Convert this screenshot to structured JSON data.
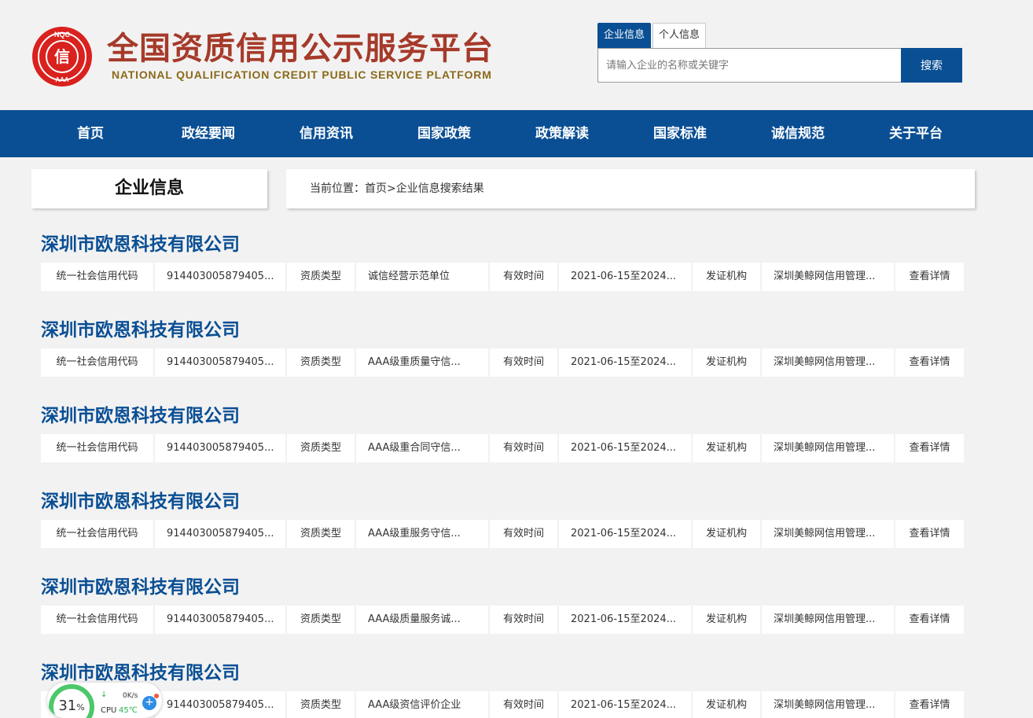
{
  "brand": {
    "logo_text_top": "NQC",
    "logo_char": "信",
    "logo_text_bottom": "AAA",
    "title": "全国资质信用公示服务平台",
    "subtitle": "NATIONAL QUALIFICATION CREDIT PUBLIC SERVICE PLATFORM",
    "colors": {
      "title": "#a63a2a",
      "subtitle": "#8a6a1a",
      "logo": "#d9211e"
    }
  },
  "search": {
    "tabs": [
      {
        "label": "企业信息",
        "active": true
      },
      {
        "label": "个人信息",
        "active": false
      }
    ],
    "placeholder": "请输入企业的名称或关键字",
    "value": "",
    "button_label": "搜索"
  },
  "nav": {
    "items": [
      "首页",
      "政经要闻",
      "信用资讯",
      "国家政策",
      "政策解读",
      "国家标准",
      "诚信规范",
      "关于平台"
    ],
    "background": "#0a4f94"
  },
  "section": {
    "title": "企业信息",
    "breadcrumb_prefix": "当前位置：",
    "breadcrumb_home": "首页",
    "breadcrumb_sep": ">",
    "breadcrumb_current": "企业信息搜索结果"
  },
  "labels": {
    "credit_code": "统一社会信用代码",
    "qual_type": "资质类型",
    "valid_time": "有效时间",
    "issuer": "发证机构",
    "detail": "查看详情"
  },
  "results": [
    {
      "company": "深圳市欧恩科技有限公司",
      "code": "914403005879405...",
      "type": "诚信经营示范单位",
      "valid": "2021-06-15至2024...",
      "issuer": "深圳美鲸网信用管理..."
    },
    {
      "company": "深圳市欧恩科技有限公司",
      "code": "914403005879405...",
      "type": "AAA级重质量守信...",
      "valid": "2021-06-15至2024...",
      "issuer": "深圳美鲸网信用管理..."
    },
    {
      "company": "深圳市欧恩科技有限公司",
      "code": "914403005879405...",
      "type": "AAA级重合同守信...",
      "valid": "2021-06-15至2024...",
      "issuer": "深圳美鲸网信用管理..."
    },
    {
      "company": "深圳市欧恩科技有限公司",
      "code": "914403005879405...",
      "type": "AAA级重服务守信...",
      "valid": "2021-06-15至2024...",
      "issuer": "深圳美鲸网信用管理..."
    },
    {
      "company": "深圳市欧恩科技有限公司",
      "code": "914403005879405...",
      "type": "AAA级质量服务诚...",
      "valid": "2021-06-15至2024...",
      "issuer": "深圳美鲸网信用管理..."
    },
    {
      "company": "深圳市欧恩科技有限公司",
      "code": "914403005879405...",
      "type": "AAA级资信评价企业",
      "valid": "2021-06-15至2024...",
      "issuer": "深圳美鲸网信用管理..."
    }
  ],
  "widget": {
    "cpu_percent": "31",
    "percent_sign": "%",
    "net_speed": "0K/s",
    "cpu_label": "CPU",
    "cpu_temp": "45℃",
    "plus": "+"
  }
}
